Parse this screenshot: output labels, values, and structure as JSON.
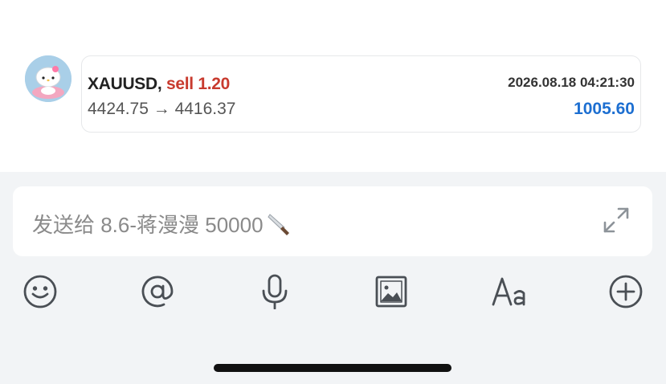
{
  "message": {
    "symbol": "XAUUSD,",
    "side": "sell",
    "volume": "1.20",
    "prices": "4424.75 → 4416.37",
    "time": "2026.08.18 04:21:30",
    "profit": "1005.60"
  },
  "composer": {
    "placeholder": "发送给 8.6-蒋漫漫 50000",
    "placeholder_emoji": "knife-emoji"
  },
  "toolbar": {
    "icons": [
      "emoji-icon",
      "mention-icon",
      "microphone-icon",
      "image-icon",
      "font-format-icon",
      "add-icon"
    ]
  },
  "colors": {
    "sell": "#c83a2e",
    "profit": "#1d6fd1",
    "composer_bg": "#f2f4f6"
  }
}
